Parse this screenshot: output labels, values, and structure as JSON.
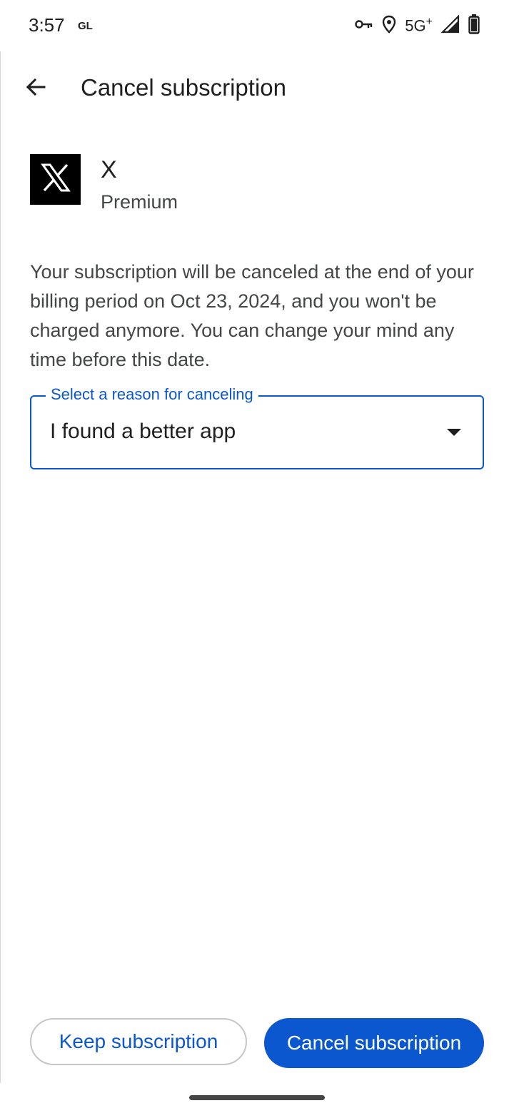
{
  "status_bar": {
    "time": "3:57",
    "carrier_badge": "GL",
    "network": "5G",
    "network_superscript": "+",
    "icons": [
      "vpn-key-icon",
      "location-icon",
      "signal-icon",
      "battery-icon"
    ]
  },
  "app_bar": {
    "title": "Cancel subscription",
    "back_icon": "arrow-back-icon"
  },
  "app": {
    "name": "X",
    "plan": "Premium",
    "logo_icon": "x-logo-icon"
  },
  "message": "Your subscription will be canceled at the end of your billing period on Oct 23, 2024, and you won't be charged anymore. You can change your mind any time before this date.",
  "reason_select": {
    "label": "Select a reason for canceling",
    "value": "I found a better app"
  },
  "buttons": {
    "keep": "Keep subscription",
    "cancel": "Cancel subscription"
  },
  "colors": {
    "accent": "#0b57d0",
    "text_primary": "#1f1f1f",
    "text_secondary": "#444746",
    "outline": "#c4c7c5"
  }
}
